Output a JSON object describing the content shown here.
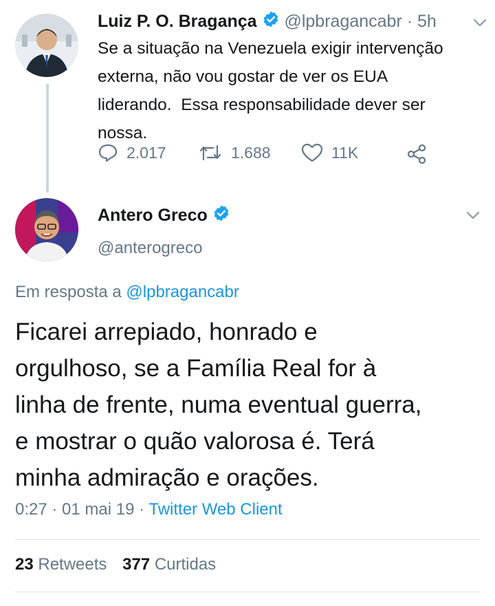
{
  "tweet1": {
    "name": "Luiz P. O. Bragança",
    "handle": "@lpbragancabr",
    "separator": " · ",
    "time": "5h",
    "text": "Se a situação na Venezuela exigir intervenção\nexterna, não vou gostar de ver os EUA\nliderando.  Essa responsabilidade dever ser\nnossa.",
    "replies": "2.017",
    "retweets": "1.688",
    "likes": "11K",
    "icons": [
      "reply-icon",
      "retweet-icon",
      "heart-icon",
      "share-icon",
      "chevron-down-icon",
      "verified-badge-icon"
    ]
  },
  "tweet2": {
    "name": "Antero Greco",
    "handle": "@anterogreco",
    "reply_prefix": "Em resposta a ",
    "reply_to": "@lpbragancabr",
    "text": "Ficarei arrepiado, honrado e\norgulhoso, se a Família Real for à\nlinha de frente, numa eventual guerra,\ne mostrar o quão valorosa é. Terá\nminha admiração e orações.",
    "time": "0:27",
    "date": "01 mai 19",
    "separator": " · ",
    "source": "Twitter Web Client",
    "retweets_count": "23",
    "retweets_label": "Retweets",
    "likes_count": "377",
    "likes_label": "Curtidas"
  },
  "colors": {
    "text": "#14171a",
    "muted": "#657786",
    "link": "#1b95e0",
    "verified": "#1da1f2",
    "divider": "#e1e8ed"
  }
}
